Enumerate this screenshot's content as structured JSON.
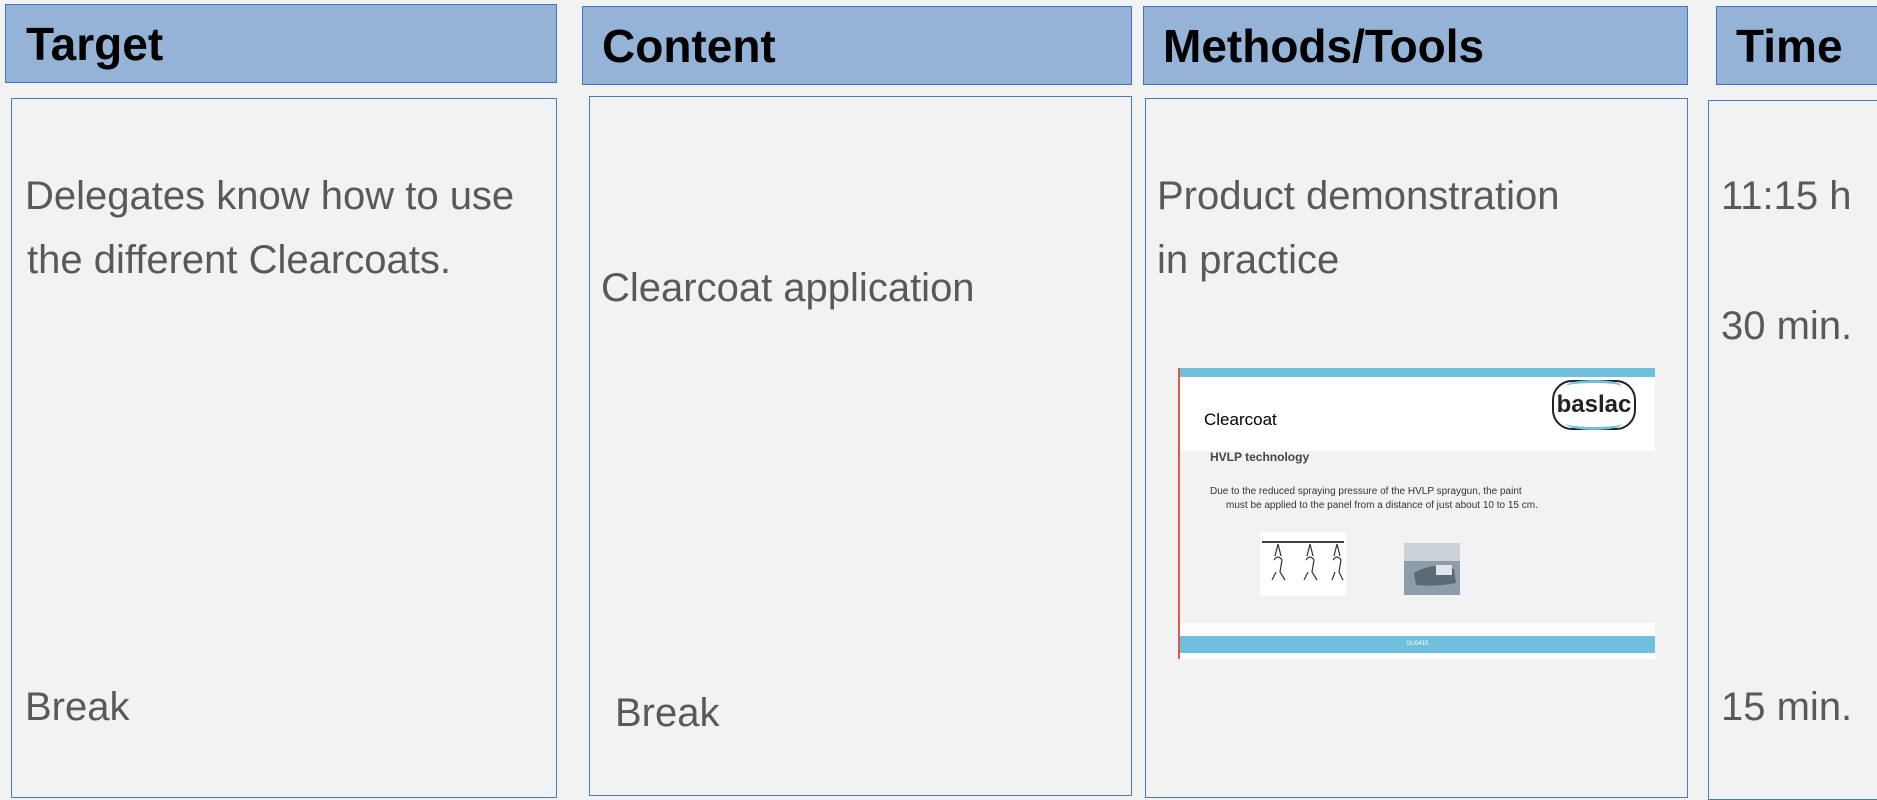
{
  "headers": {
    "target": "Target",
    "content": "Content",
    "methods": "Methods/Tools",
    "time": "Time"
  },
  "target": {
    "objective_line1": "Delegates know how to use",
    "objective_line2": "the different Clearcoats.",
    "break": "Break"
  },
  "content": {
    "topic": "Clearcoat application",
    "break": "Break"
  },
  "methods": {
    "line1": "Product demonstration",
    "line2": "in practice",
    "slide": {
      "title": "Clearcoat",
      "subtitle": "HVLP technology",
      "text_line1": "Due to the reduced spraying pressure of the HVLP spraygun, the paint",
      "text_line2": "must be applied to the panel from a distance of just about 10 to 15 cm.",
      "logo": "baslac",
      "footer": "01/0415"
    }
  },
  "time": {
    "start": "11:15 h",
    "duration": "30 min.",
    "break": "15 min."
  },
  "colors": {
    "header_fill": "#95b3d7",
    "border": "#4a7ebb",
    "text": "#595959",
    "background": "#f2f2f2"
  }
}
